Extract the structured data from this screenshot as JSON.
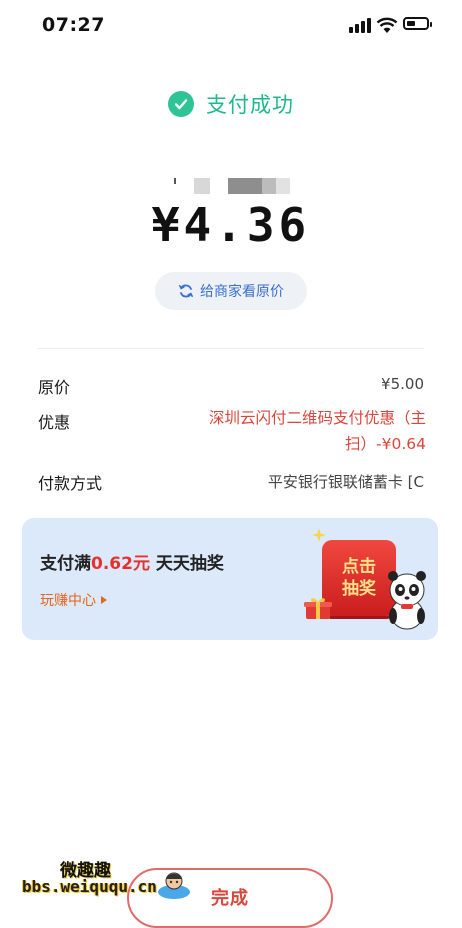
{
  "status_bar": {
    "time": "07:27"
  },
  "header": {
    "title": "支付成功"
  },
  "payment": {
    "amount": "¥4.36",
    "view_original_label": "给商家看原价"
  },
  "details": {
    "original_label": "原价",
    "original_value": "¥5.00",
    "discount_label": "优惠",
    "discount_line1": "深圳云闪付二维码支付优惠（主",
    "discount_line2": "扫）-¥0.64",
    "method_label": "付款方式",
    "method_value": "平安银行银联储蓄卡 [C"
  },
  "promo": {
    "title_prefix": "支付满",
    "title_amount": "0.62元",
    "title_suffix": "天天抽奖",
    "link_label": "玩赚中心",
    "draw_line1": "点击",
    "draw_line2": "抽奖"
  },
  "footer": {
    "done_label": "完成",
    "watermark_logo": "微趣趣",
    "watermark_url": "bbs.weiququ.cn"
  },
  "colors": {
    "success_green": "#1fb88d",
    "discount_red": "#d9463c",
    "link_blue": "#3a6fd0",
    "promo_bg": "#dce9fa"
  },
  "icons": [
    "signal-icon",
    "wifi-icon",
    "battery-icon",
    "check-icon",
    "refresh-icon",
    "gift-icon",
    "panda-icon",
    "sparkle-icon",
    "mascot-icon"
  ]
}
